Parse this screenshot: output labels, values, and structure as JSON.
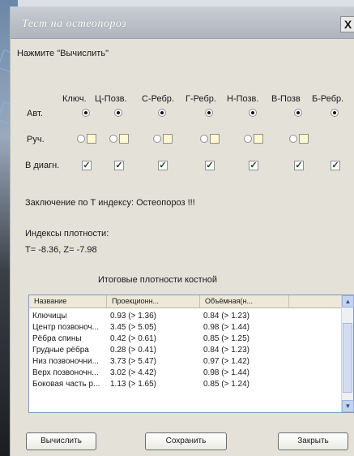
{
  "window": {
    "title": "Тест на остеопороз",
    "close_label": "X"
  },
  "instruction": "Нажмите \"Вычислить\"",
  "columns": [
    "Ключ.",
    "Ц-Позв.",
    "С-Ребр.",
    "Г-Ребр.",
    "Н-Позв.",
    "В-Позв",
    "Б-Ребр."
  ],
  "rows": {
    "auto_label": "Авт.",
    "manual_label": "Руч.",
    "diag_label": "В диагн.",
    "auto_selected": [
      true,
      true,
      true,
      true,
      true,
      true,
      true
    ],
    "diag_checked": [
      true,
      true,
      true,
      true,
      true,
      true,
      true
    ],
    "check_mark": "✓"
  },
  "conclusion": "Заключение по Т индексу: Остеопороз !!!",
  "indices": {
    "title": "Индексы плотности:",
    "values": "T= -8.36, Z= -7.98"
  },
  "table": {
    "title": "Итоговые плотности костной",
    "headers": [
      "Название",
      "Проекционн...",
      "Объёмная(н..."
    ],
    "rows": [
      [
        "Ключицы",
        "0.93 (> 1.36)",
        "0.84 (> 1.23)"
      ],
      [
        "Центр позвоноч...",
        "3.45 (> 5.05)",
        "0.98 (> 1.44)"
      ],
      [
        "Рёбра спины",
        "0.42 (> 0.61)",
        "0.85 (> 1.25)"
      ],
      [
        "Грудные рёбра",
        "0.28 (> 0.41)",
        "0.84 (> 1.23)"
      ],
      [
        "Низ позвоночни...",
        "3.73 (> 5.47)",
        "0.97 (> 1.42)"
      ],
      [
        "Верх позвоночн...",
        "3.02 (> 4.42)",
        "0.98 (> 1.44)"
      ],
      [
        "Боковая часть р...",
        "1.13 (> 1.65)",
        "0.85 (> 1.24)"
      ]
    ]
  },
  "buttons": {
    "calculate": "Вычислить",
    "save": "Сохранить",
    "close": "Закрыть"
  },
  "scroll_up": "▲",
  "scroll_down": "▼"
}
